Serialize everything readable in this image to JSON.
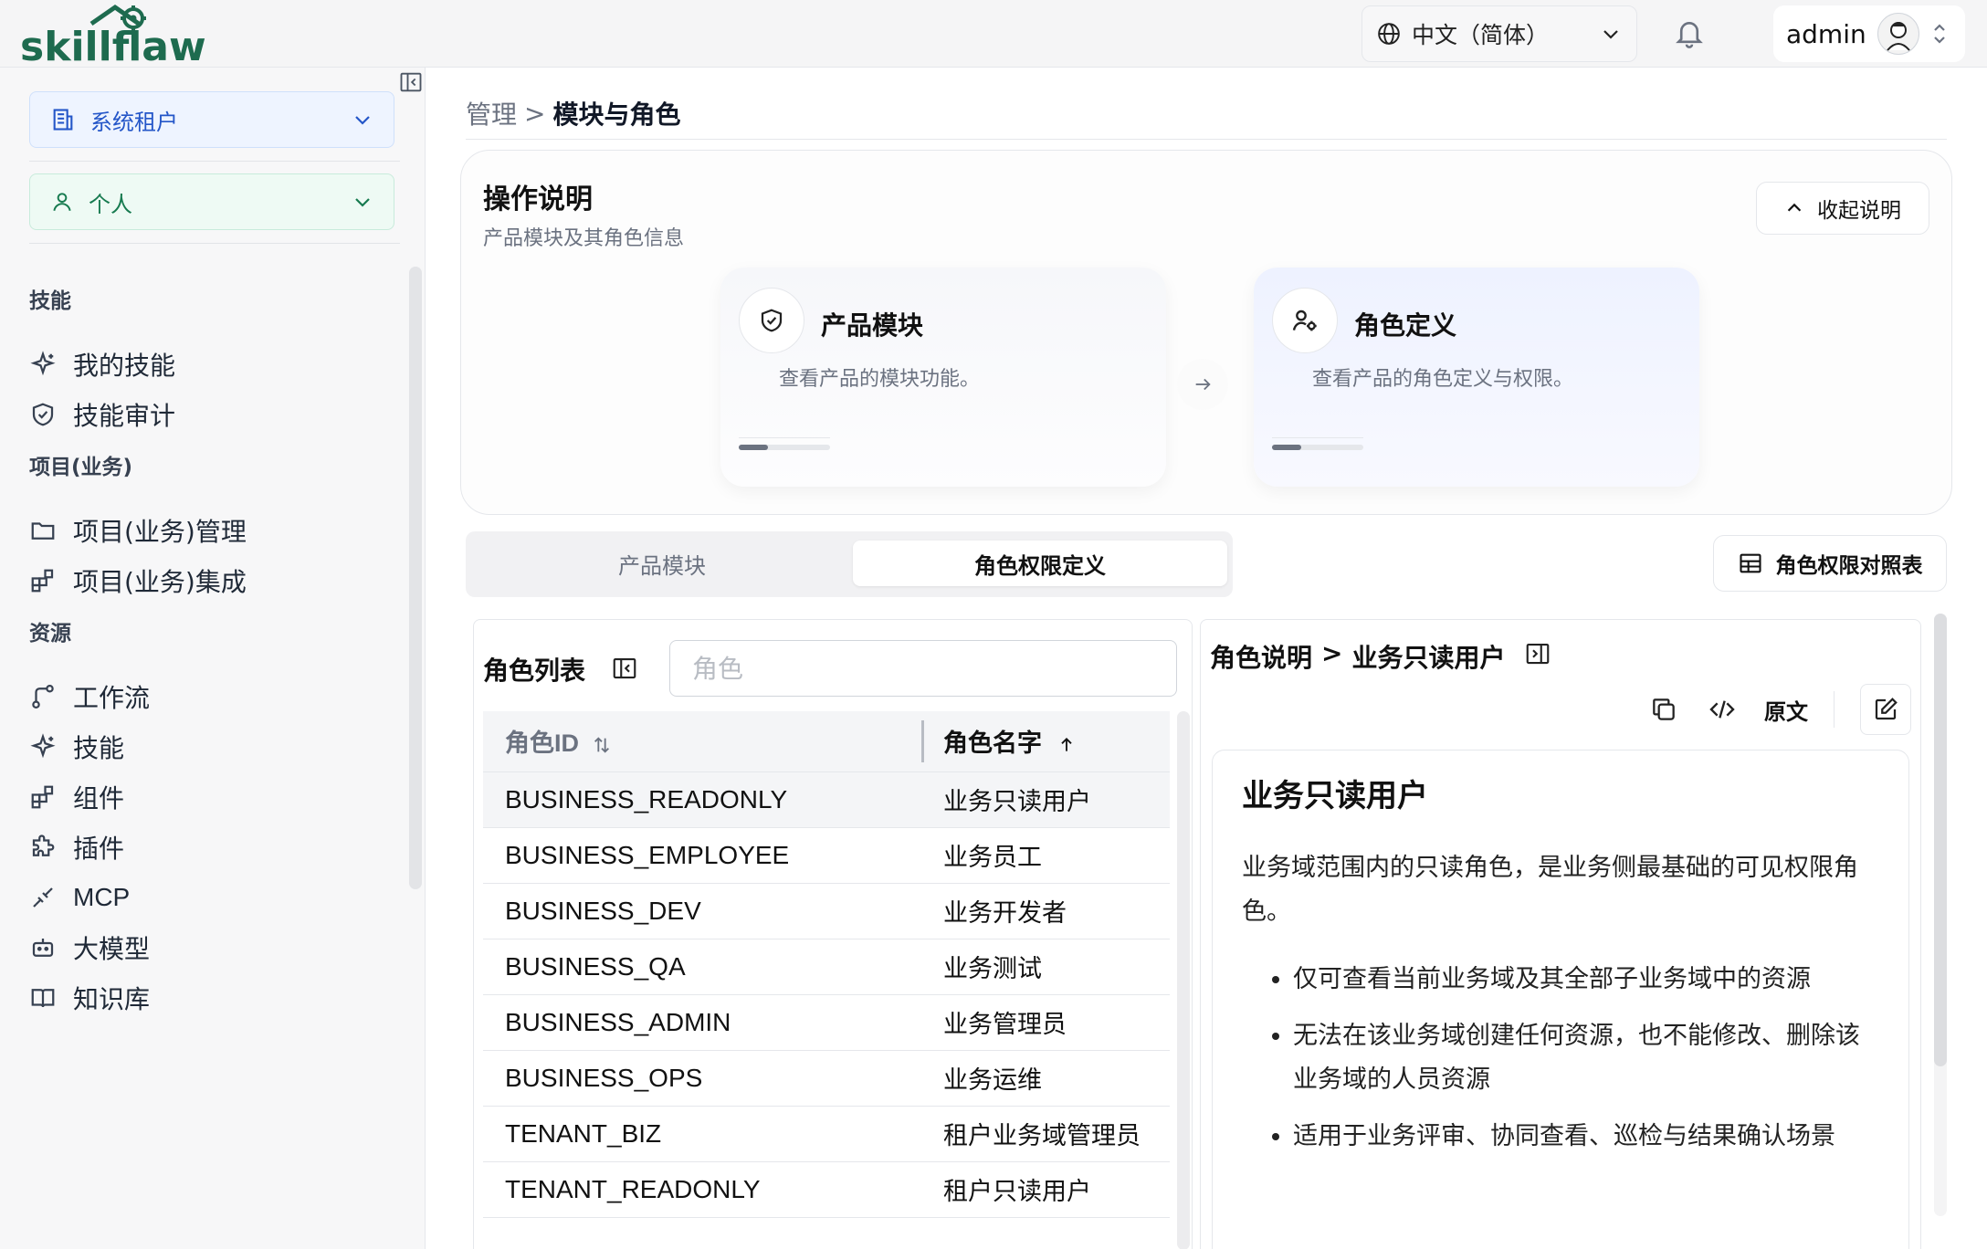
{
  "header": {
    "brand": "skillflaw",
    "language": "中文（简体）",
    "username": "admin"
  },
  "sidebar": {
    "tenant": "系统租户",
    "scope": "个人",
    "sections": [
      {
        "title": "技能",
        "items": [
          "我的技能",
          "技能审计"
        ]
      },
      {
        "title": "项目(业务)",
        "items": [
          "项目(业务)管理",
          "项目(业务)集成"
        ]
      },
      {
        "title": "资源",
        "items": [
          "工作流",
          "技能",
          "组件",
          "插件",
          "MCP",
          "大模型",
          "知识库"
        ]
      }
    ]
  },
  "breadcrumb": {
    "parent": "管理",
    "separator": ">",
    "current": "模块与角色"
  },
  "help": {
    "title": "操作说明",
    "subtitle": "产品模块及其角色信息",
    "collapse_label": "收起说明",
    "steps": [
      {
        "title": "产品模块",
        "desc": "查看产品的模块功能。"
      },
      {
        "title": "角色定义",
        "desc": "查看产品的角色定义与权限。"
      }
    ]
  },
  "tabs": [
    {
      "label": "产品模块",
      "active": false
    },
    {
      "label": "角色权限定义",
      "active": true
    }
  ],
  "matrix_button": "角色权限对照表",
  "role_list": {
    "title": "角色列表",
    "search_placeholder": "角色",
    "columns": [
      "角色ID",
      "角色名字"
    ],
    "rows": [
      {
        "id": "BUSINESS_READONLY",
        "name": "业务只读用户",
        "selected": true
      },
      {
        "id": "BUSINESS_EMPLOYEE",
        "name": "业务员工"
      },
      {
        "id": "BUSINESS_DEV",
        "name": "业务开发者"
      },
      {
        "id": "BUSINESS_QA",
        "name": "业务测试"
      },
      {
        "id": "BUSINESS_ADMIN",
        "name": "业务管理员"
      },
      {
        "id": "BUSINESS_OPS",
        "name": "业务运维"
      },
      {
        "id": "TENANT_BIZ",
        "name": "租户业务域管理员"
      },
      {
        "id": "TENANT_READONLY",
        "name": "租户只读用户"
      }
    ]
  },
  "detail": {
    "crumb_parent": "角色说明",
    "crumb_sep": ">",
    "crumb_current": "业务只读用户",
    "raw_label": "原文",
    "heading": "业务只读用户",
    "intro": "业务域范围内的只读角色，是业务侧最基础的可见权限角色。",
    "bullets": [
      "仅可查看当前业务域及其全部子业务域中的资源",
      "无法在该业务域创建任何资源，也不能修改、删除该业务域的人员资源",
      "适用于业务评审、协同查看、巡检与结果确认场景"
    ]
  },
  "colors": {
    "accent_blue": "#2456c8",
    "accent_green": "#167a4f",
    "logo_green": "#1e6b4f"
  }
}
